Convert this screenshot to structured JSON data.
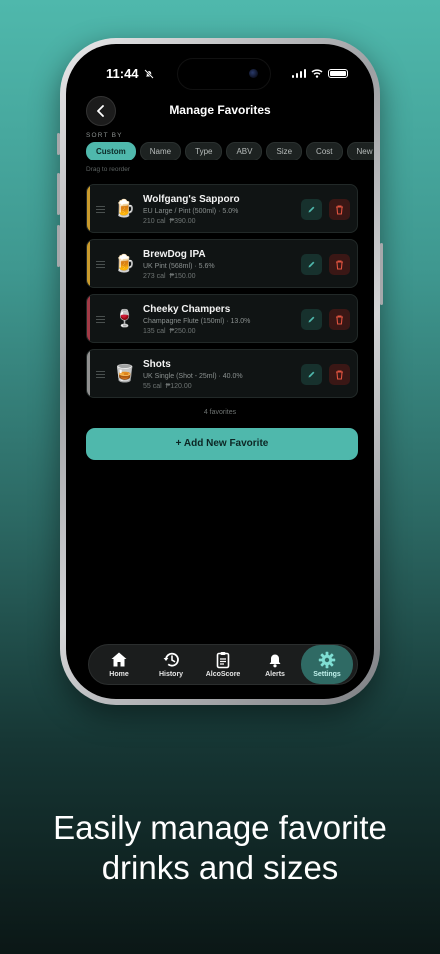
{
  "status": {
    "time": "11:44"
  },
  "header": {
    "title": "Manage Favorites"
  },
  "sort": {
    "label": "SORT BY",
    "options": [
      "Custom",
      "Name",
      "Type",
      "ABV",
      "Size",
      "Cost",
      "New"
    ],
    "selected": "Custom",
    "hint": "Drag to reorder"
  },
  "favorites": [
    {
      "name": "Wolfgang's Sapporo",
      "detail": "EU Large / Pint (500ml) · 5.0%",
      "cal": "210 cal",
      "price": "₱390.00",
      "icon": "beer-mug-icon",
      "glyph": "🍺",
      "accent": "#c99a2c"
    },
    {
      "name": "BrewDog IPA",
      "detail": "UK Pint (568ml) · 5.6%",
      "cal": "273 cal",
      "price": "₱150.00",
      "icon": "beer-mug-icon",
      "glyph": "🍺",
      "accent": "#c99a2c"
    },
    {
      "name": "Cheeky Champers",
      "detail": "Champagne Flute (150ml) · 13.0%",
      "cal": "135 cal",
      "price": "₱250.00",
      "icon": "wine-glass-icon",
      "glyph": "🍷",
      "accent": "#a23a46"
    },
    {
      "name": "Shots",
      "detail": "UK Single (Shot - 25ml) · 40.0%",
      "cal": "55 cal",
      "price": "₱120.00",
      "icon": "whisky-tumbler-icon",
      "glyph": "🥃",
      "accent": "#8f8f8f"
    }
  ],
  "count_text": "4 favorites",
  "add_button": "+ Add New Favorite",
  "tabs": [
    {
      "label": "Home",
      "icon": "home-icon"
    },
    {
      "label": "History",
      "icon": "history-icon"
    },
    {
      "label": "AlcoScore",
      "icon": "clipboard-icon"
    },
    {
      "label": "Alerts",
      "icon": "bell-icon"
    },
    {
      "label": "Settings",
      "icon": "gear-icon",
      "active": true
    }
  ],
  "caption": {
    "line1": "Easily manage favorite",
    "line2": "drinks and sizes"
  },
  "colors": {
    "accent": "#4fb8ac",
    "delete": "#e0533f",
    "background": "#000000"
  }
}
